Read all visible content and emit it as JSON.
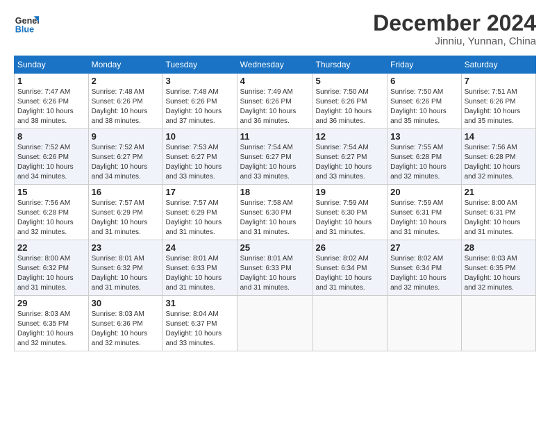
{
  "header": {
    "logo_line1": "General",
    "logo_line2": "Blue",
    "month_year": "December 2024",
    "location": "Jinniu, Yunnan, China"
  },
  "days_of_week": [
    "Sunday",
    "Monday",
    "Tuesday",
    "Wednesday",
    "Thursday",
    "Friday",
    "Saturday"
  ],
  "weeks": [
    [
      {
        "day": "1",
        "info": "Sunrise: 7:47 AM\nSunset: 6:26 PM\nDaylight: 10 hours\nand 38 minutes."
      },
      {
        "day": "2",
        "info": "Sunrise: 7:48 AM\nSunset: 6:26 PM\nDaylight: 10 hours\nand 38 minutes."
      },
      {
        "day": "3",
        "info": "Sunrise: 7:48 AM\nSunset: 6:26 PM\nDaylight: 10 hours\nand 37 minutes."
      },
      {
        "day": "4",
        "info": "Sunrise: 7:49 AM\nSunset: 6:26 PM\nDaylight: 10 hours\nand 36 minutes."
      },
      {
        "day": "5",
        "info": "Sunrise: 7:50 AM\nSunset: 6:26 PM\nDaylight: 10 hours\nand 36 minutes."
      },
      {
        "day": "6",
        "info": "Sunrise: 7:50 AM\nSunset: 6:26 PM\nDaylight: 10 hours\nand 35 minutes."
      },
      {
        "day": "7",
        "info": "Sunrise: 7:51 AM\nSunset: 6:26 PM\nDaylight: 10 hours\nand 35 minutes."
      }
    ],
    [
      {
        "day": "8",
        "info": "Sunrise: 7:52 AM\nSunset: 6:26 PM\nDaylight: 10 hours\nand 34 minutes."
      },
      {
        "day": "9",
        "info": "Sunrise: 7:52 AM\nSunset: 6:27 PM\nDaylight: 10 hours\nand 34 minutes."
      },
      {
        "day": "10",
        "info": "Sunrise: 7:53 AM\nSunset: 6:27 PM\nDaylight: 10 hours\nand 33 minutes."
      },
      {
        "day": "11",
        "info": "Sunrise: 7:54 AM\nSunset: 6:27 PM\nDaylight: 10 hours\nand 33 minutes."
      },
      {
        "day": "12",
        "info": "Sunrise: 7:54 AM\nSunset: 6:27 PM\nDaylight: 10 hours\nand 33 minutes."
      },
      {
        "day": "13",
        "info": "Sunrise: 7:55 AM\nSunset: 6:28 PM\nDaylight: 10 hours\nand 32 minutes."
      },
      {
        "day": "14",
        "info": "Sunrise: 7:56 AM\nSunset: 6:28 PM\nDaylight: 10 hours\nand 32 minutes."
      }
    ],
    [
      {
        "day": "15",
        "info": "Sunrise: 7:56 AM\nSunset: 6:28 PM\nDaylight: 10 hours\nand 32 minutes."
      },
      {
        "day": "16",
        "info": "Sunrise: 7:57 AM\nSunset: 6:29 PM\nDaylight: 10 hours\nand 31 minutes."
      },
      {
        "day": "17",
        "info": "Sunrise: 7:57 AM\nSunset: 6:29 PM\nDaylight: 10 hours\nand 31 minutes."
      },
      {
        "day": "18",
        "info": "Sunrise: 7:58 AM\nSunset: 6:30 PM\nDaylight: 10 hours\nand 31 minutes."
      },
      {
        "day": "19",
        "info": "Sunrise: 7:59 AM\nSunset: 6:30 PM\nDaylight: 10 hours\nand 31 minutes."
      },
      {
        "day": "20",
        "info": "Sunrise: 7:59 AM\nSunset: 6:31 PM\nDaylight: 10 hours\nand 31 minutes."
      },
      {
        "day": "21",
        "info": "Sunrise: 8:00 AM\nSunset: 6:31 PM\nDaylight: 10 hours\nand 31 minutes."
      }
    ],
    [
      {
        "day": "22",
        "info": "Sunrise: 8:00 AM\nSunset: 6:32 PM\nDaylight: 10 hours\nand 31 minutes."
      },
      {
        "day": "23",
        "info": "Sunrise: 8:01 AM\nSunset: 6:32 PM\nDaylight: 10 hours\nand 31 minutes."
      },
      {
        "day": "24",
        "info": "Sunrise: 8:01 AM\nSunset: 6:33 PM\nDaylight: 10 hours\nand 31 minutes."
      },
      {
        "day": "25",
        "info": "Sunrise: 8:01 AM\nSunset: 6:33 PM\nDaylight: 10 hours\nand 31 minutes."
      },
      {
        "day": "26",
        "info": "Sunrise: 8:02 AM\nSunset: 6:34 PM\nDaylight: 10 hours\nand 31 minutes."
      },
      {
        "day": "27",
        "info": "Sunrise: 8:02 AM\nSunset: 6:34 PM\nDaylight: 10 hours\nand 32 minutes."
      },
      {
        "day": "28",
        "info": "Sunrise: 8:03 AM\nSunset: 6:35 PM\nDaylight: 10 hours\nand 32 minutes."
      }
    ],
    [
      {
        "day": "29",
        "info": "Sunrise: 8:03 AM\nSunset: 6:35 PM\nDaylight: 10 hours\nand 32 minutes."
      },
      {
        "day": "30",
        "info": "Sunrise: 8:03 AM\nSunset: 6:36 PM\nDaylight: 10 hours\nand 32 minutes."
      },
      {
        "day": "31",
        "info": "Sunrise: 8:04 AM\nSunset: 6:37 PM\nDaylight: 10 hours\nand 33 minutes."
      },
      null,
      null,
      null,
      null
    ]
  ]
}
